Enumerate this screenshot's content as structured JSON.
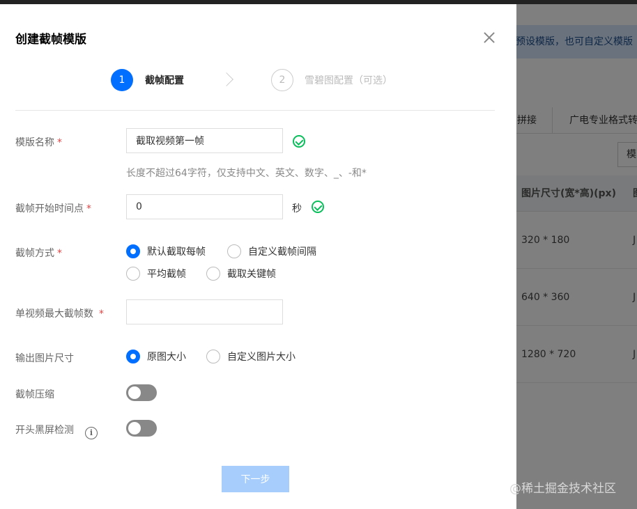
{
  "background": {
    "notice_text": "预设模版，也可自定义模版",
    "tabs": [
      "拼接",
      "广电专业格式转"
    ],
    "button_partial": "模",
    "table_header": "图片尺寸(宽*高)(px)",
    "table_header_tail": "图",
    "rows": [
      {
        "size": "320 * 180",
        "tail": "J"
      },
      {
        "size": "640 * 360",
        "tail": "J"
      },
      {
        "size": "1280 * 720",
        "tail": "J"
      }
    ]
  },
  "modal": {
    "title": "创建截帧模版",
    "steps": [
      {
        "number": "1",
        "label": "截帧配置"
      },
      {
        "number": "2",
        "label": "雪碧图配置（可选）"
      }
    ],
    "form": {
      "template_name": {
        "label": "模版名称",
        "required_mark": "*",
        "value": "截取视频第一帧",
        "hint": "长度不超过64字符，仅支持中文、英文、数字、_、-和*"
      },
      "start_time": {
        "label": "截帧开始时间点",
        "required_mark": "*",
        "value": "0",
        "unit": "秒"
      },
      "capture_mode": {
        "label": "截帧方式",
        "required_mark": "*",
        "options": [
          "默认截取每帧",
          "自定义截帧间隔",
          "平均截帧",
          "截取关键帧"
        ],
        "selected": "默认截取每帧"
      },
      "max_frames": {
        "label": "单视频最大截帧数",
        "required_mark": "*",
        "value": ""
      },
      "output_size": {
        "label": "输出图片尺寸",
        "options": [
          "原图大小",
          "自定义图片大小"
        ],
        "selected": "原图大小"
      },
      "compression": {
        "label": "截帧压缩",
        "enabled": false
      },
      "black_screen": {
        "label": "开头黑屏检测",
        "enabled": false,
        "info_icon": "i"
      }
    },
    "next_button": "下一步"
  },
  "watermark": "@稀土掘金技术社区",
  "colors": {
    "primary": "#006eff",
    "success": "#0abf5b",
    "required": "#e54545",
    "disabled_button": "#a6cdfb"
  }
}
